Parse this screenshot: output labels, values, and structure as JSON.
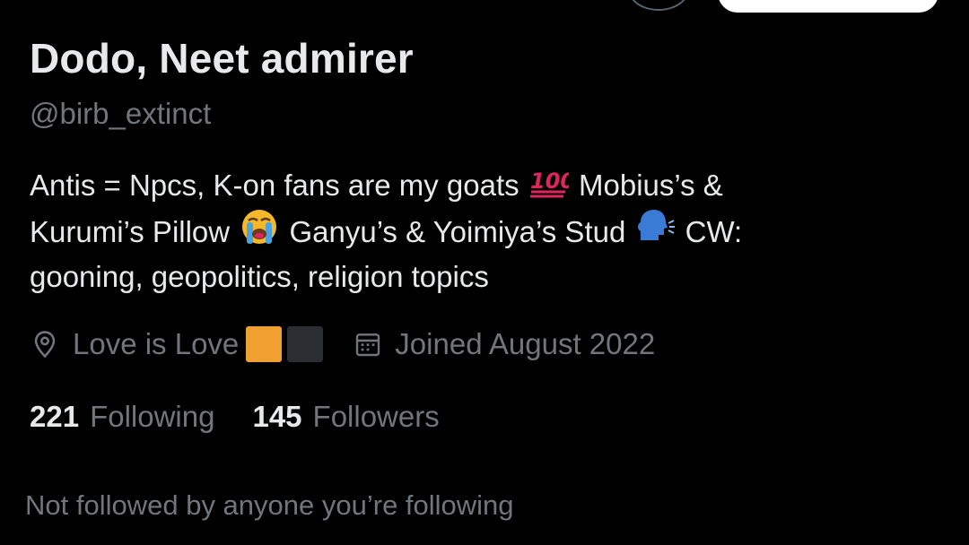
{
  "profile": {
    "display_name": "Dodo, Neet admirer",
    "handle": "@birb_extinct",
    "bio": {
      "line1_a": "Antis = Npcs, K-on fans are my goats",
      "line1_b": "Mobius’s &",
      "line2_a": "Kurumi’s Pillow",
      "line2_b": "Ganyu’s & Yoimiya’s Stud",
      "line2_c": "CW:",
      "line3": "gooning, geopolitics, religion topics"
    },
    "bio_emoji": [
      "hundred-points-emoji",
      "loudly-crying-face-emoji",
      "speaking-head-emoji"
    ],
    "location": "Love is Love",
    "location_flag_colors": [
      "#f0a030",
      "#2a2d31"
    ],
    "joined": "Joined August 2022",
    "following_count": "221",
    "following_label": "Following",
    "followers_count": "145",
    "followers_label": "Followers",
    "followed_by_text": "Not followed by anyone you’re following"
  },
  "colors": {
    "background": "#000000",
    "primary_text": "#e7e9ea",
    "secondary_text": "#71767b"
  },
  "icons": [
    "location-pin-icon",
    "calendar-icon"
  ]
}
